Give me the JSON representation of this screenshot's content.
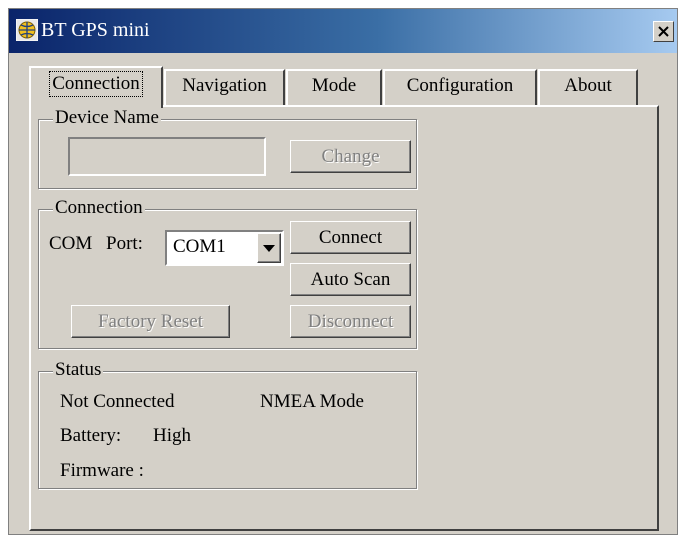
{
  "window": {
    "title": "BT GPS mini",
    "icon": "gps-globe-icon",
    "close_icon": "close-x-icon"
  },
  "tabs": [
    {
      "label": "Connection",
      "active": true
    },
    {
      "label": "Navigation",
      "active": false
    },
    {
      "label": "Mode",
      "active": false
    },
    {
      "label": "Configuration",
      "active": false
    },
    {
      "label": "About",
      "active": false
    }
  ],
  "device_name": {
    "group_label": "Device Name",
    "value": "",
    "change_button": "Change"
  },
  "connection": {
    "group_label": "Connection",
    "com_label": "COM",
    "port_label": "Port:",
    "port_value": "COM1",
    "connect_button": "Connect",
    "auto_scan_button": "Auto Scan",
    "factory_reset_button": "Factory Reset",
    "disconnect_button": "Disconnect"
  },
  "status": {
    "group_label": "Status",
    "connection_state": "Not Connected",
    "mode": "NMEA Mode",
    "battery_label": "Battery:",
    "battery_value": "High",
    "firmware_label": "Firmware :",
    "firmware_value": ""
  }
}
